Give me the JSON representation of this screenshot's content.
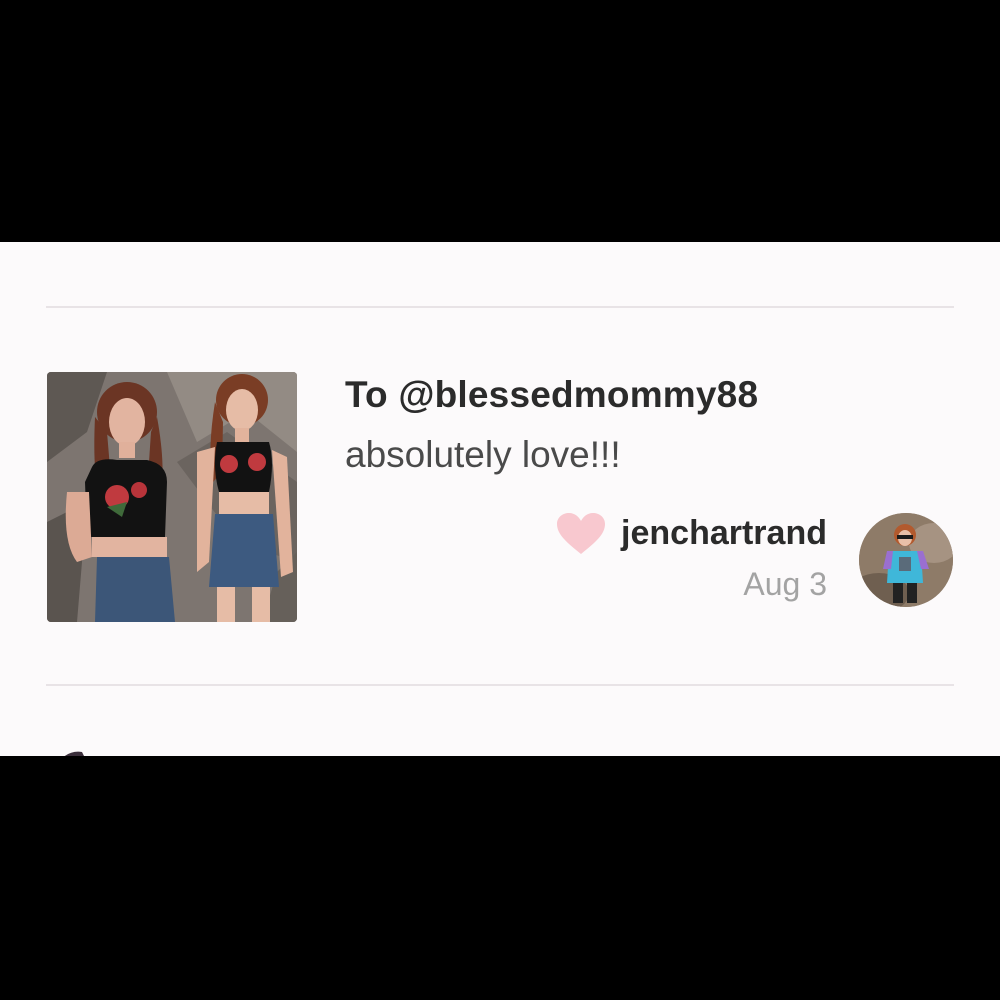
{
  "notification": {
    "recipient": "To @blessedmommy88",
    "message": "absolutely love!!!",
    "username": "jenchartrand",
    "date": "Aug 3"
  },
  "icons": {
    "like": "heart-icon"
  },
  "colors": {
    "heart": "#f8c8cf",
    "background": "#fcfafb",
    "divider": "#e8e3e6",
    "date_text": "#a3a3a3",
    "primary_text": "#2b2b2b"
  }
}
